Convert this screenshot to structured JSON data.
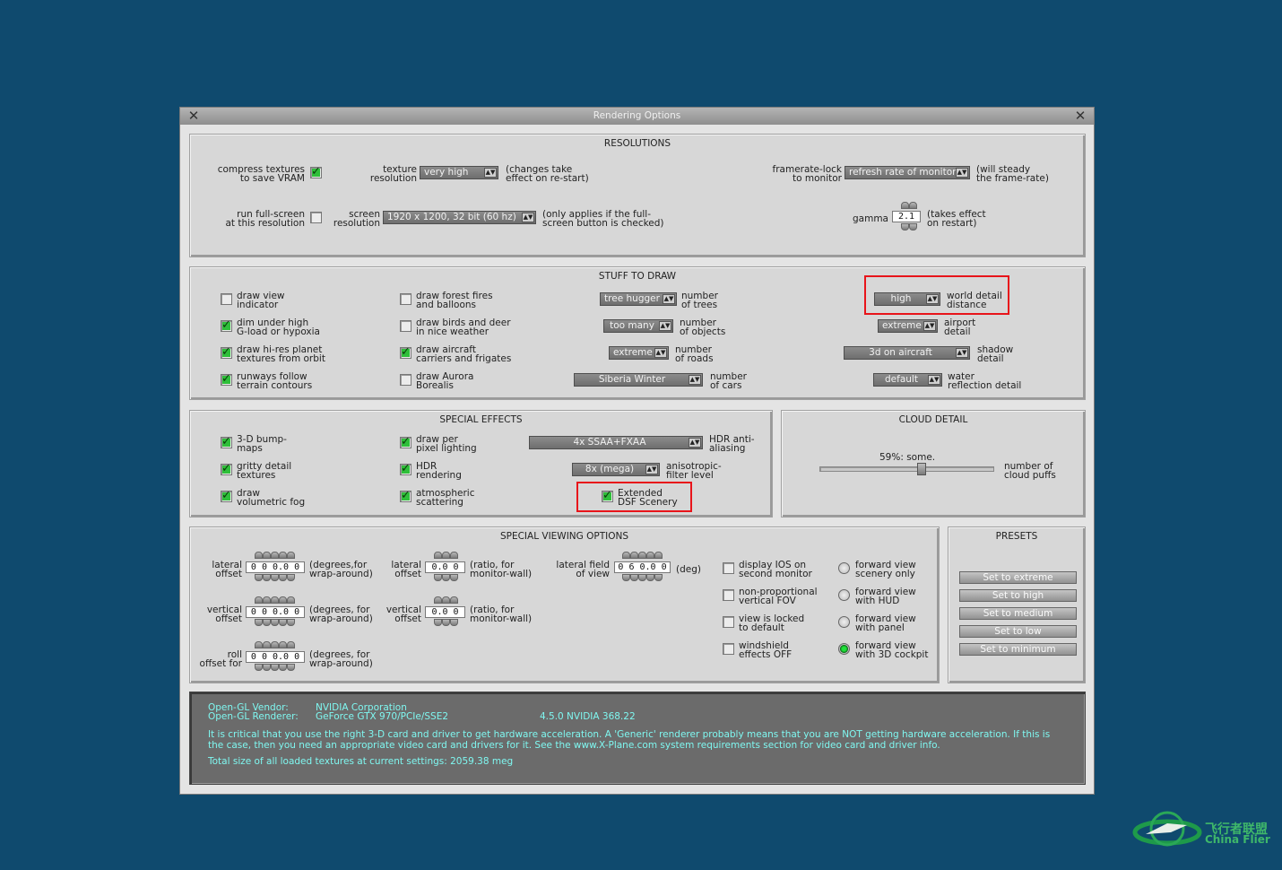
{
  "window": {
    "title": "Rendering Options"
  },
  "resolutions": {
    "title": "RESOLUTIONS",
    "compress": {
      "label1": "compress textures",
      "label2": "to save VRAM",
      "checked": true
    },
    "texture": {
      "label1": "texture",
      "label2": "resolution",
      "value": "very high",
      "note1": "(changes take",
      "note2": "effect on re-start)"
    },
    "framerate": {
      "label1": "framerate-lock",
      "label2": "to monitor",
      "value": "refresh rate of monitor",
      "note1": "(will steady",
      "note2": "the frame-rate)"
    },
    "fullscreen": {
      "label1": "run full-screen",
      "label2": "at this resolution",
      "checked": false
    },
    "screen": {
      "label1": "screen",
      "label2": "resolution",
      "value": "1920 x 1200, 32 bit (60 hz)",
      "note1": "(only applies if the full-",
      "note2": "screen button is checked)"
    },
    "gamma": {
      "label": "gamma",
      "value": "2.1",
      "note1": "(takes effect",
      "note2": "on restart)"
    }
  },
  "stuff": {
    "title": "STUFF TO DRAW",
    "col1": [
      {
        "l1": "draw view",
        "l2": "indicator",
        "checked": false
      },
      {
        "l1": "dim under high",
        "l2": "G-load or hypoxia",
        "checked": true
      },
      {
        "l1": "draw hi-res planet",
        "l2": "textures from orbit",
        "checked": true
      },
      {
        "l1": "runways follow",
        "l2": "terrain contours",
        "checked": true
      }
    ],
    "col2": [
      {
        "l1": "draw forest fires",
        "l2": "and balloons",
        "checked": false
      },
      {
        "l1": "draw birds and deer",
        "l2": "in nice weather",
        "checked": false
      },
      {
        "l1": "draw aircraft",
        "l2": "carriers and frigates",
        "checked": true
      },
      {
        "l1": "draw Aurora",
        "l2": "Borealis",
        "checked": false
      }
    ],
    "col3": [
      {
        "value": "tree hugger",
        "l1": "number",
        "l2": "of trees"
      },
      {
        "value": "too many",
        "l1": "number",
        "l2": "of objects"
      },
      {
        "value": "extreme",
        "l1": "number",
        "l2": "of roads"
      },
      {
        "value": "Siberia Winter",
        "l1": "number",
        "l2": "of cars"
      }
    ],
    "col4": [
      {
        "value": "high",
        "l1": "world detail",
        "l2": "distance"
      },
      {
        "value": "extreme",
        "l1": "airport",
        "l2": "detail"
      },
      {
        "value": "3d on aircraft",
        "l1": "shadow",
        "l2": "detail"
      },
      {
        "value": "default",
        "l1": "water",
        "l2": "reflection detail"
      }
    ]
  },
  "effects": {
    "title": "SPECIAL EFFECTS",
    "col1": [
      {
        "l1": "3-D bump-",
        "l2": "maps",
        "checked": true
      },
      {
        "l1": "gritty detail",
        "l2": "textures",
        "checked": true
      },
      {
        "l1": "draw",
        "l2": "volumetric fog",
        "checked": true
      }
    ],
    "col2": [
      {
        "l1": "draw per",
        "l2": "pixel lighting",
        "checked": true
      },
      {
        "l1": "HDR",
        "l2": "rendering",
        "checked": true
      },
      {
        "l1": "atmospheric",
        "l2": "scattering",
        "checked": true
      }
    ],
    "hdr_aa": {
      "value": "4x SSAA+FXAA",
      "l1": "HDR anti-",
      "l2": "aliasing"
    },
    "aniso": {
      "value": "8x (mega)",
      "l1": "anisotropic-",
      "l2": "filter level"
    },
    "dsf": {
      "l1": "Extended",
      "l2": "DSF Scenery",
      "checked": true
    }
  },
  "cloud": {
    "title": "CLOUD DETAIL",
    "status": "59%: some.",
    "level": 0.59,
    "l1": "number of",
    "l2": "cloud puffs"
  },
  "viewing": {
    "title": "SPECIAL VIEWING OPTIONS",
    "lat": {
      "l1": "lateral",
      "l2": "offset",
      "value": "0 0 0.0 0",
      "n1": "(degrees,for",
      "n2": "wrap-around)"
    },
    "vert": {
      "l1": "vertical",
      "l2": "offset",
      "value": "0 0 0.0 0",
      "n1": "(degrees, for",
      "n2": "wrap-around)"
    },
    "roll": {
      "l1": "roll",
      "l2": "offset for",
      "value": "0 0 0.0 0",
      "n1": "(degrees, for",
      "n2": "wrap-around)"
    },
    "lat2": {
      "l1": "lateral",
      "l2": "offset",
      "value": "0.0 0",
      "n1": "(ratio, for",
      "n2": "monitor-wall)"
    },
    "vert2": {
      "l1": "vertical",
      "l2": "offset",
      "value": "0.0 0",
      "n1": "(ratio, for",
      "n2": "monitor-wall)"
    },
    "fov": {
      "l1": "lateral field",
      "l2": "of view",
      "value": "0 6 0.0 0",
      "n1": "(deg)"
    },
    "checks": [
      {
        "l1": "display IOS on",
        "l2": "second monitor",
        "checked": false
      },
      {
        "l1": "non-proportional",
        "l2": "vertical FOV",
        "checked": false
      },
      {
        "l1": "view is locked",
        "l2": "to default",
        "checked": false
      },
      {
        "l1": "windshield",
        "l2": "effects OFF",
        "checked": false
      }
    ],
    "radios": [
      {
        "l1": "forward view",
        "l2": "scenery only",
        "selected": false
      },
      {
        "l1": "forward view",
        "l2": "with HUD",
        "selected": false
      },
      {
        "l1": "forward view",
        "l2": "with panel",
        "selected": false
      },
      {
        "l1": "forward view",
        "l2": "with 3D cockpit",
        "selected": true
      }
    ]
  },
  "presets": {
    "title": "PRESETS",
    "buttons": [
      "Set to extreme",
      "Set to high",
      "Set to medium",
      "Set to low",
      "Set to minimum"
    ]
  },
  "info": {
    "vendor_label": "Open-GL Vendor:",
    "vendor": "NVIDIA Corporation",
    "renderer_label": "Open-GL Renderer:",
    "renderer": "GeForce GTX 970/PCIe/SSE2",
    "version": "4.5.0 NVIDIA 368.22",
    "warn1": "It is critical that you use the right 3-D card and driver to get hardware acceleration. A 'Generic' renderer probably means that you are NOT getting hardware acceleration. If this is",
    "warn2": "the case, then you need an appropriate video card and drivers for it. See the www.X-Plane.com system requirements section for video card and driver info.",
    "total": "Total size of all loaded textures at current settings: 2059.38 meg"
  },
  "watermark": {
    "cn": "飞行者联盟",
    "en": "China Flier"
  }
}
